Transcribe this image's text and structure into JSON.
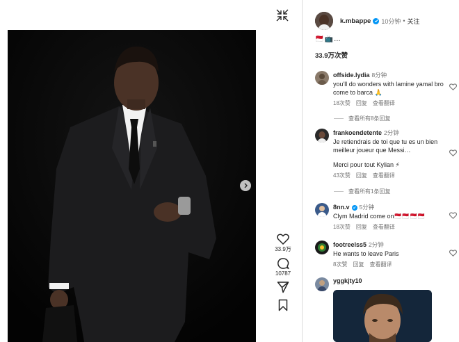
{
  "post": {
    "username": "k.mbappe",
    "time": "10分钟",
    "dot": "•",
    "follow_label": "关注",
    "caption": "🇲🇨📺…",
    "likes_summary": "33.9万次赞"
  },
  "actions": {
    "like_count": "33.9万",
    "comment_count": "10787"
  },
  "comments": [
    {
      "user": "offside.lydia",
      "time": "8分钟",
      "text": "you'll do wonders with lamine yamal bro come to barca 🙏",
      "likes": "18次赞",
      "reply_label": "回复",
      "translate_label": "查看翻译",
      "view_replies": "查看所有8条回复"
    },
    {
      "user": "frankoendetente",
      "time": "2分钟",
      "text": "Je retiendrais de toi que tu es un bien meilleur joueur que Messi…",
      "extra": "Merci pour tout Kylian ⚡",
      "likes": "43次赞",
      "reply_label": "回复",
      "translate_label": "查看翻译",
      "view_replies": "查看所有1条回复"
    },
    {
      "user": "8nn.v",
      "time": "5分钟",
      "text": "Clym Madrid come on🇲🇨🇲🇨🇲🇨🇲🇨",
      "likes": "18次赞",
      "reply_label": "回复",
      "translate_label": "查看翻译"
    },
    {
      "user": "footreelss5",
      "time": "2分钟",
      "text": "He wants to leave Paris",
      "likes": "8次赞",
      "reply_label": "回复",
      "translate_label": "查看翻译"
    },
    {
      "user": "yggkjty10"
    }
  ],
  "colors": {
    "verified": "#0095f6",
    "muted_text": "#737373",
    "divider": "#dbdbdb"
  }
}
